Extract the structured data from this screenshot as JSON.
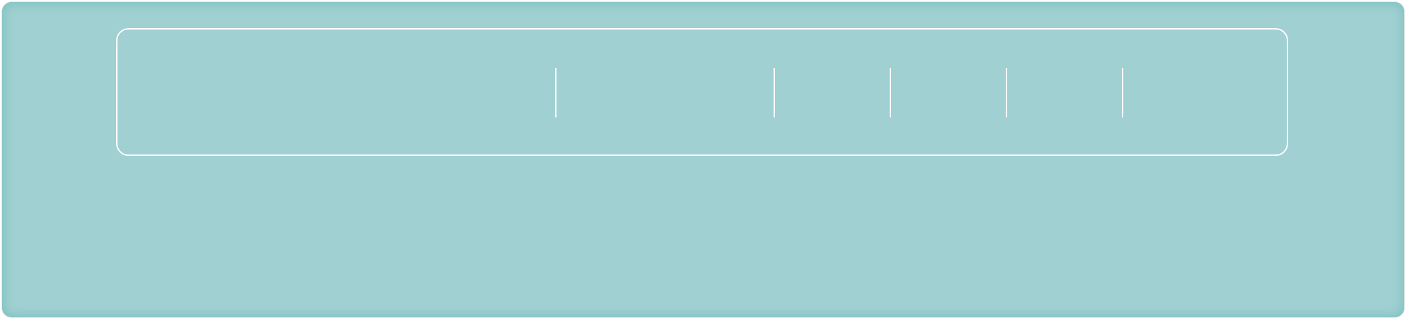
{
  "colors": {
    "panel_background": "#a1d0d2",
    "panel_glow": "#78bebe",
    "menu_outline": "#ffffff",
    "divider": "#ffffff"
  },
  "menu": {
    "items": [
      {
        "label": ""
      },
      {
        "label": ""
      },
      {
        "label": ""
      },
      {
        "label": ""
      },
      {
        "label": ""
      },
      {
        "label": ""
      }
    ]
  }
}
